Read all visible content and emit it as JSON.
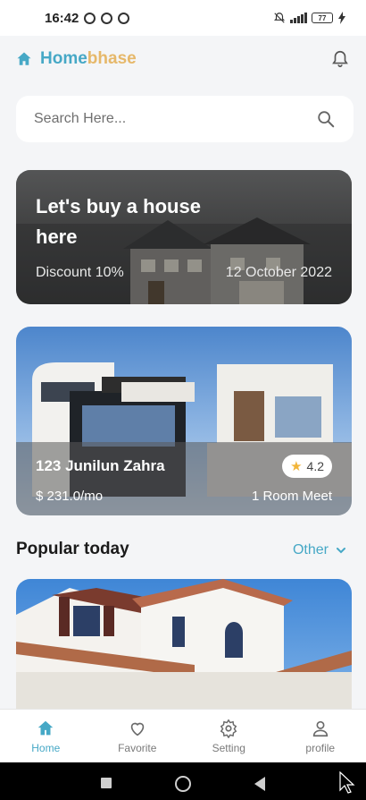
{
  "status_bar": {
    "time": "16:42",
    "battery": "77"
  },
  "header": {
    "brand_part1": "Home",
    "brand_part2": "bhase"
  },
  "search": {
    "placeholder": "Search Here..."
  },
  "promo": {
    "title": "Let's buy a house here",
    "discount": "Discount 10%",
    "date": "12 October 2022"
  },
  "featured": {
    "name": "123 Junilun Zahra",
    "rating": "4.2",
    "price": "$ 231.0/mo",
    "rooms": "1 Room Meet"
  },
  "popular": {
    "title": "Popular today",
    "other_label": "Other"
  },
  "bottom_nav": {
    "items": [
      {
        "label": "Home",
        "icon": "home-icon",
        "active": true
      },
      {
        "label": "Favorite",
        "icon": "heart-icon"
      },
      {
        "label": "Setting",
        "icon": "gear-icon"
      },
      {
        "label": "profile",
        "icon": "user-icon"
      }
    ]
  },
  "colors": {
    "accent": "#46a8c6",
    "brand_secondary": "#e6b86a",
    "background": "#f4f5f7",
    "star": "#f2b53a"
  }
}
